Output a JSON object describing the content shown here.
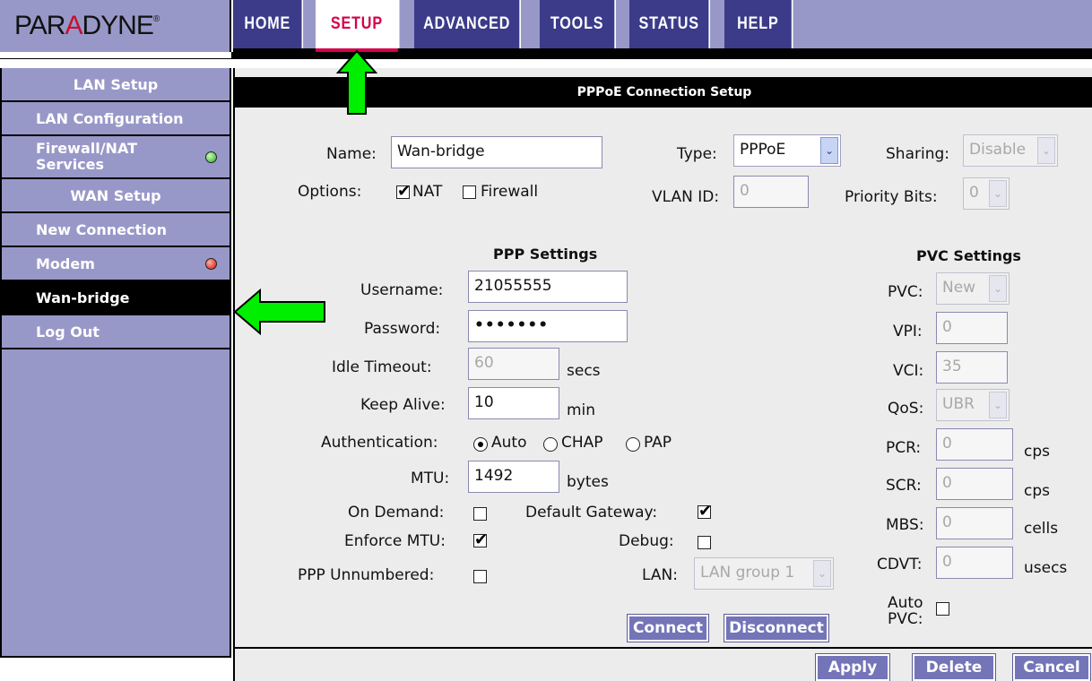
{
  "logo": {
    "text_pre": "PAR",
    "text_accent": "A",
    "text_post": "DYNE",
    "mark": "®"
  },
  "nav": {
    "tabs": [
      {
        "label": "HOME",
        "active": false
      },
      {
        "label": "SETUP",
        "active": true
      },
      {
        "label": "ADVANCED",
        "active": false
      },
      {
        "label": "TOOLS",
        "active": false
      },
      {
        "label": "STATUS",
        "active": false
      },
      {
        "label": "HELP",
        "active": false
      }
    ]
  },
  "sidebar": {
    "lan_setup_header": "LAN Setup",
    "lan_configuration": "LAN Configuration",
    "firewall_nat": "Firewall/NAT Services",
    "wan_setup_header": "WAN Setup",
    "new_connection": "New Connection",
    "modem": "Modem",
    "wan_bridge": "Wan-bridge",
    "log_out": "Log Out",
    "firewall_status": "green",
    "modem_status": "red"
  },
  "page_title": "PPPoE Connection Setup",
  "general": {
    "name_label": "Name:",
    "name_value": "Wan-bridge",
    "type_label": "Type:",
    "type_value": "PPPoE",
    "sharing_label": "Sharing:",
    "sharing_value": "Disable",
    "options_label": "Options:",
    "nat_label": "NAT",
    "nat_checked": true,
    "firewall_label": "Firewall",
    "firewall_checked": false,
    "vlan_label": "VLAN ID:",
    "vlan_value": "0",
    "priority_label": "Priority Bits:",
    "priority_value": "0"
  },
  "ppp": {
    "heading": "PPP Settings",
    "username_label": "Username:",
    "username_value": "21055555",
    "password_label": "Password:",
    "password_value": "•••••••",
    "idle_label": "Idle Timeout:",
    "idle_value": "60",
    "idle_unit": "secs",
    "keepalive_label": "Keep Alive:",
    "keepalive_value": "10",
    "keepalive_unit": "min",
    "auth_label": "Authentication:",
    "auth_auto": "Auto",
    "auth_chap": "CHAP",
    "auth_pap": "PAP",
    "auth_selected": "Auto",
    "mtu_label": "MTU:",
    "mtu_value": "1492",
    "mtu_unit": "bytes",
    "on_demand_label": "On Demand:",
    "on_demand_checked": false,
    "default_gw_label": "Default Gateway:",
    "default_gw_checked": true,
    "enforce_mtu_label": "Enforce MTU:",
    "enforce_mtu_checked": true,
    "debug_label": "Debug:",
    "debug_checked": false,
    "unnumbered_label": "PPP Unnumbered:",
    "unnumbered_checked": false,
    "lan_label": "LAN:",
    "lan_value": "LAN group 1",
    "connect_label": "Connect",
    "disconnect_label": "Disconnect"
  },
  "pvc": {
    "heading": "PVC Settings",
    "pvc_label": "PVC:",
    "pvc_value": "New",
    "vpi_label": "VPI:",
    "vpi_value": "0",
    "vci_label": "VCI:",
    "vci_value": "35",
    "qos_label": "QoS:",
    "qos_value": "UBR",
    "pcr_label": "PCR:",
    "pcr_value": "0",
    "pcr_unit": "cps",
    "scr_label": "SCR:",
    "scr_value": "0",
    "scr_unit": "cps",
    "mbs_label": "MBS:",
    "mbs_value": "0",
    "mbs_unit": "cells",
    "cdvt_label": "CDVT:",
    "cdvt_value": "0",
    "cdvt_unit": "usecs",
    "auto_pvc_label_1": "Auto",
    "auto_pvc_label_2": "PVC:",
    "auto_pvc_checked": false
  },
  "actions": {
    "apply": "Apply",
    "delete": "Delete",
    "cancel": "Cancel"
  },
  "colors": {
    "nav_bg": "#9898c8",
    "tab_bg": "#3b3b8a",
    "active_tab_text": "#d4004a",
    "button_bg": "#7474b8",
    "arrow_green": "#00ee00"
  },
  "icons": {
    "checkmark": "✔",
    "dropdown": "⌄"
  }
}
